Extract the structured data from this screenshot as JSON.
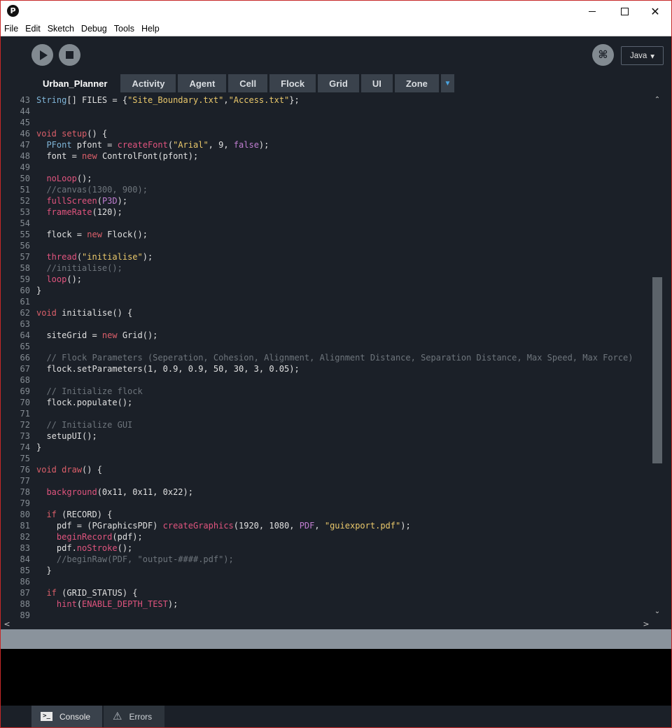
{
  "titlebar": {
    "logo_glyph": "P",
    "minimize_icon": "minimize-icon",
    "maximize_icon": "maximize-icon",
    "close_glyph": "✕"
  },
  "menu": [
    "File",
    "Edit",
    "Sketch",
    "Debug",
    "Tools",
    "Help"
  ],
  "toolbar": {
    "run_icon": "play-icon",
    "stop_icon": "stop-icon",
    "debug_glyph": "⌘",
    "mode_label": "Java",
    "mode_arrow": "▾"
  },
  "tabs": [
    "Urban_Planner",
    "Activity",
    "Agent",
    "Cell",
    "Flock",
    "Grid",
    "UI",
    "Zone"
  ],
  "tab_more_glyph": "▼",
  "colors": {
    "keyword": "#dc5f6a",
    "function": "#e0547e",
    "type": "#7fb5d8",
    "constant": "#c07ed1",
    "string": "#eac86b",
    "comment": "#6e757c",
    "default": "#e0e0e0"
  },
  "code_lines": [
    {
      "n": "43",
      "tokens": [
        [
          "type",
          "String"
        ],
        [
          "default",
          "[] FILES = {"
        ],
        [
          "string",
          "\"Site_Boundary.txt\""
        ],
        [
          "default",
          ","
        ],
        [
          "string",
          "\"Access.txt\""
        ],
        [
          "default",
          "};"
        ]
      ]
    },
    {
      "n": "44",
      "tokens": []
    },
    {
      "n": "45",
      "tokens": []
    },
    {
      "n": "46",
      "tokens": [
        [
          "keyword",
          "void"
        ],
        [
          "default",
          " "
        ],
        [
          "keyword",
          "setup"
        ],
        [
          "default",
          "() {"
        ]
      ]
    },
    {
      "n": "47",
      "tokens": [
        [
          "default",
          "  "
        ],
        [
          "type",
          "PFont"
        ],
        [
          "default",
          " pfont = "
        ],
        [
          "function",
          "createFont"
        ],
        [
          "default",
          "("
        ],
        [
          "string",
          "\"Arial\""
        ],
        [
          "default",
          ", 9, "
        ],
        [
          "constant",
          "false"
        ],
        [
          "default",
          ");"
        ]
      ]
    },
    {
      "n": "48",
      "tokens": [
        [
          "default",
          "  font = "
        ],
        [
          "keyword",
          "new"
        ],
        [
          "default",
          " ControlFont(pfont);"
        ]
      ]
    },
    {
      "n": "49",
      "tokens": []
    },
    {
      "n": "50",
      "tokens": [
        [
          "default",
          "  "
        ],
        [
          "function",
          "noLoop"
        ],
        [
          "default",
          "();"
        ]
      ]
    },
    {
      "n": "51",
      "tokens": [
        [
          "comment",
          "  //canvas(1300, 900);"
        ]
      ]
    },
    {
      "n": "52",
      "tokens": [
        [
          "default",
          "  "
        ],
        [
          "function",
          "fullScreen"
        ],
        [
          "default",
          "("
        ],
        [
          "constant",
          "P3D"
        ],
        [
          "default",
          ");"
        ]
      ]
    },
    {
      "n": "53",
      "tokens": [
        [
          "default",
          "  "
        ],
        [
          "function",
          "frameRate"
        ],
        [
          "default",
          "(120);"
        ]
      ]
    },
    {
      "n": "54",
      "tokens": []
    },
    {
      "n": "55",
      "tokens": [
        [
          "default",
          "  flock = "
        ],
        [
          "keyword",
          "new"
        ],
        [
          "default",
          " Flock();"
        ]
      ]
    },
    {
      "n": "56",
      "tokens": []
    },
    {
      "n": "57",
      "tokens": [
        [
          "default",
          "  "
        ],
        [
          "function",
          "thread"
        ],
        [
          "default",
          "("
        ],
        [
          "string",
          "\"initialise\""
        ],
        [
          "default",
          ");"
        ]
      ]
    },
    {
      "n": "58",
      "tokens": [
        [
          "comment",
          "  //initialise();"
        ]
      ]
    },
    {
      "n": "59",
      "tokens": [
        [
          "default",
          "  "
        ],
        [
          "function",
          "loop"
        ],
        [
          "default",
          "();"
        ]
      ]
    },
    {
      "n": "60",
      "tokens": [
        [
          "default",
          "}"
        ]
      ]
    },
    {
      "n": "61",
      "tokens": []
    },
    {
      "n": "62",
      "tokens": [
        [
          "keyword",
          "void"
        ],
        [
          "default",
          " initialise() {"
        ]
      ]
    },
    {
      "n": "63",
      "tokens": []
    },
    {
      "n": "64",
      "tokens": [
        [
          "default",
          "  siteGrid = "
        ],
        [
          "keyword",
          "new"
        ],
        [
          "default",
          " Grid();"
        ]
      ]
    },
    {
      "n": "65",
      "tokens": []
    },
    {
      "n": "66",
      "tokens": [
        [
          "comment",
          "  // Flock Parameters (Seperation, Cohesion, Alignment, Alignment Distance, Separation Distance, Max Speed, Max Force)"
        ]
      ]
    },
    {
      "n": "67",
      "tokens": [
        [
          "default",
          "  flock.setParameters(1, 0.9, 0.9, 50, 30, 3, 0.05);"
        ]
      ]
    },
    {
      "n": "68",
      "tokens": []
    },
    {
      "n": "69",
      "tokens": [
        [
          "comment",
          "  // Initialize flock"
        ]
      ]
    },
    {
      "n": "70",
      "tokens": [
        [
          "default",
          "  flock.populate();"
        ]
      ]
    },
    {
      "n": "71",
      "tokens": []
    },
    {
      "n": "72",
      "tokens": [
        [
          "comment",
          "  // Initialize GUI"
        ]
      ]
    },
    {
      "n": "73",
      "tokens": [
        [
          "default",
          "  setupUI();"
        ]
      ]
    },
    {
      "n": "74",
      "tokens": [
        [
          "default",
          "}"
        ]
      ]
    },
    {
      "n": "75",
      "tokens": []
    },
    {
      "n": "76",
      "tokens": [
        [
          "keyword",
          "void"
        ],
        [
          "default",
          " "
        ],
        [
          "keyword",
          "draw"
        ],
        [
          "default",
          "() {"
        ]
      ]
    },
    {
      "n": "77",
      "tokens": []
    },
    {
      "n": "78",
      "tokens": [
        [
          "default",
          "  "
        ],
        [
          "function",
          "background"
        ],
        [
          "default",
          "(0x11, 0x11, 0x22);"
        ]
      ]
    },
    {
      "n": "79",
      "tokens": []
    },
    {
      "n": "80",
      "tokens": [
        [
          "default",
          "  "
        ],
        [
          "keyword",
          "if"
        ],
        [
          "default",
          " (RECORD) {"
        ]
      ]
    },
    {
      "n": "81",
      "tokens": [
        [
          "default",
          "    pdf = (PGraphicsPDF) "
        ],
        [
          "function",
          "createGraphics"
        ],
        [
          "default",
          "(1920, 1080, "
        ],
        [
          "constant",
          "PDF"
        ],
        [
          "default",
          ", "
        ],
        [
          "string",
          "\"guiexport.pdf\""
        ],
        [
          "default",
          ");"
        ]
      ]
    },
    {
      "n": "82",
      "tokens": [
        [
          "default",
          "    "
        ],
        [
          "function",
          "beginRecord"
        ],
        [
          "default",
          "(pdf);"
        ]
      ]
    },
    {
      "n": "83",
      "tokens": [
        [
          "default",
          "    pdf."
        ],
        [
          "function",
          "noStroke"
        ],
        [
          "default",
          "();"
        ]
      ]
    },
    {
      "n": "84",
      "tokens": [
        [
          "comment",
          "    //beginRaw(PDF, \"output-####.pdf\");"
        ]
      ]
    },
    {
      "n": "85",
      "tokens": [
        [
          "default",
          "  }"
        ]
      ]
    },
    {
      "n": "86",
      "tokens": []
    },
    {
      "n": "87",
      "tokens": [
        [
          "default",
          "  "
        ],
        [
          "keyword",
          "if"
        ],
        [
          "default",
          " (GRID_STATUS) {"
        ]
      ]
    },
    {
      "n": "88",
      "tokens": [
        [
          "default",
          "    "
        ],
        [
          "function",
          "hint"
        ],
        [
          "default",
          "("
        ],
        [
          "function",
          "ENABLE_DEPTH_TEST"
        ],
        [
          "default",
          ");"
        ]
      ]
    },
    {
      "n": "89",
      "tokens": []
    }
  ],
  "scroll": {
    "up_glyph": "⌃",
    "down_glyph": "⌄",
    "left_glyph": "<",
    "right_glyph": ">"
  },
  "footer": {
    "console_label": "Console",
    "console_glyph": ">_",
    "errors_label": "Errors",
    "errors_glyph": "⚠"
  }
}
